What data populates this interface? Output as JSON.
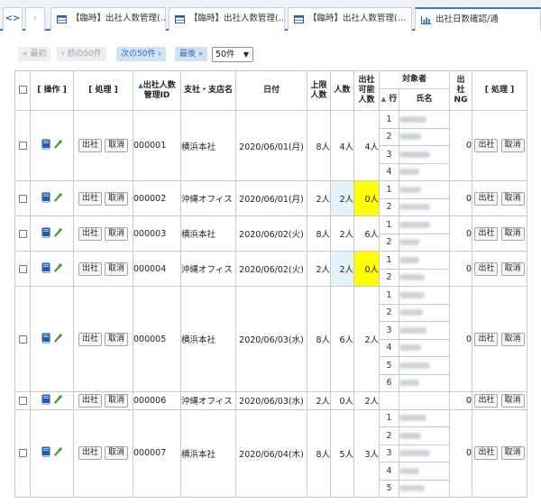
{
  "tabs": [
    {
      "label": "【臨時】出社人数管理(…",
      "icon": "table-icon"
    },
    {
      "label": "【臨時】出社人数管理(…",
      "icon": "table-icon"
    },
    {
      "label": "【臨時】出社人数管理(…",
      "icon": "table-icon"
    },
    {
      "label": "出社日数確認/通",
      "icon": "bar-chart-icon"
    }
  ],
  "tab_nav": {
    "first": "<>",
    "back": "‹"
  },
  "pager": {
    "first": "« 最初",
    "prev": "‹ 前の50件",
    "next": "次の50件 ›",
    "last": "最後 »",
    "per_page": "50件"
  },
  "headers": {
    "ops": "[ 操作 ]",
    "process": "[ 処理 ]",
    "id_1": "出社人数",
    "id_2": "管理ID",
    "branch": "支社・支店名",
    "date": "日付",
    "limit_1": "上限",
    "limit_2": "人数",
    "count": "人数",
    "avail_1": "出社",
    "avail_2": "可能",
    "avail_3": "人数",
    "target": "対象者",
    "row": "行",
    "name": "氏名",
    "ng_1": "出",
    "ng_2": "社",
    "ng_3": "NG",
    "process2": "[ 処理 ]"
  },
  "buttons": {
    "checkin": "出社",
    "cancel": "取消"
  },
  "rows": [
    {
      "id": "000001",
      "branch": "横浜本社",
      "date": "2020/06/01(月)",
      "limit": "8人",
      "count": "4人",
      "avail": "4人",
      "ng": "0",
      "members": 4,
      "count_hl": "",
      "avail_hl": ""
    },
    {
      "id": "000002",
      "branch": "沖縄オフィス",
      "date": "2020/06/01(月)",
      "limit": "2人",
      "count": "2人",
      "avail": "0人",
      "ng": "0",
      "members": 2,
      "count_hl": "blue",
      "avail_hl": "yellow"
    },
    {
      "id": "000003",
      "branch": "横浜本社",
      "date": "2020/06/02(火)",
      "limit": "8人",
      "count": "2人",
      "avail": "6人",
      "ng": "0",
      "members": 2,
      "count_hl": "",
      "avail_hl": ""
    },
    {
      "id": "000004",
      "branch": "沖縄オフィス",
      "date": "2020/06/02(火)",
      "limit": "2人",
      "count": "2人",
      "avail": "0人",
      "ng": "0",
      "members": 2,
      "count_hl": "blue",
      "avail_hl": "yellow"
    },
    {
      "id": "000005",
      "branch": "横浜本社",
      "date": "2020/06/03(水)",
      "limit": "8人",
      "count": "6人",
      "avail": "2人",
      "ng": "0",
      "members": 6,
      "count_hl": "",
      "avail_hl": ""
    },
    {
      "id": "000006",
      "branch": "沖縄オフィス",
      "date": "2020/06/03(水)",
      "limit": "2人",
      "count": "0人",
      "avail": "2人",
      "ng": "0",
      "members": 1,
      "count_hl": "",
      "avail_hl": ""
    },
    {
      "id": "000007",
      "branch": "横浜本社",
      "date": "2020/06/04(木)",
      "limit": "8人",
      "count": "5人",
      "avail": "3人",
      "ng": "0",
      "members": 5,
      "count_hl": "",
      "avail_hl": ""
    }
  ],
  "colors": {
    "accent": "#2b7fc0",
    "blue_highlight": "#e4f3fa",
    "yellow_highlight": "#ffff00",
    "book_icon": "#1f5fae",
    "pencil_icon": "#4d9a3c"
  }
}
